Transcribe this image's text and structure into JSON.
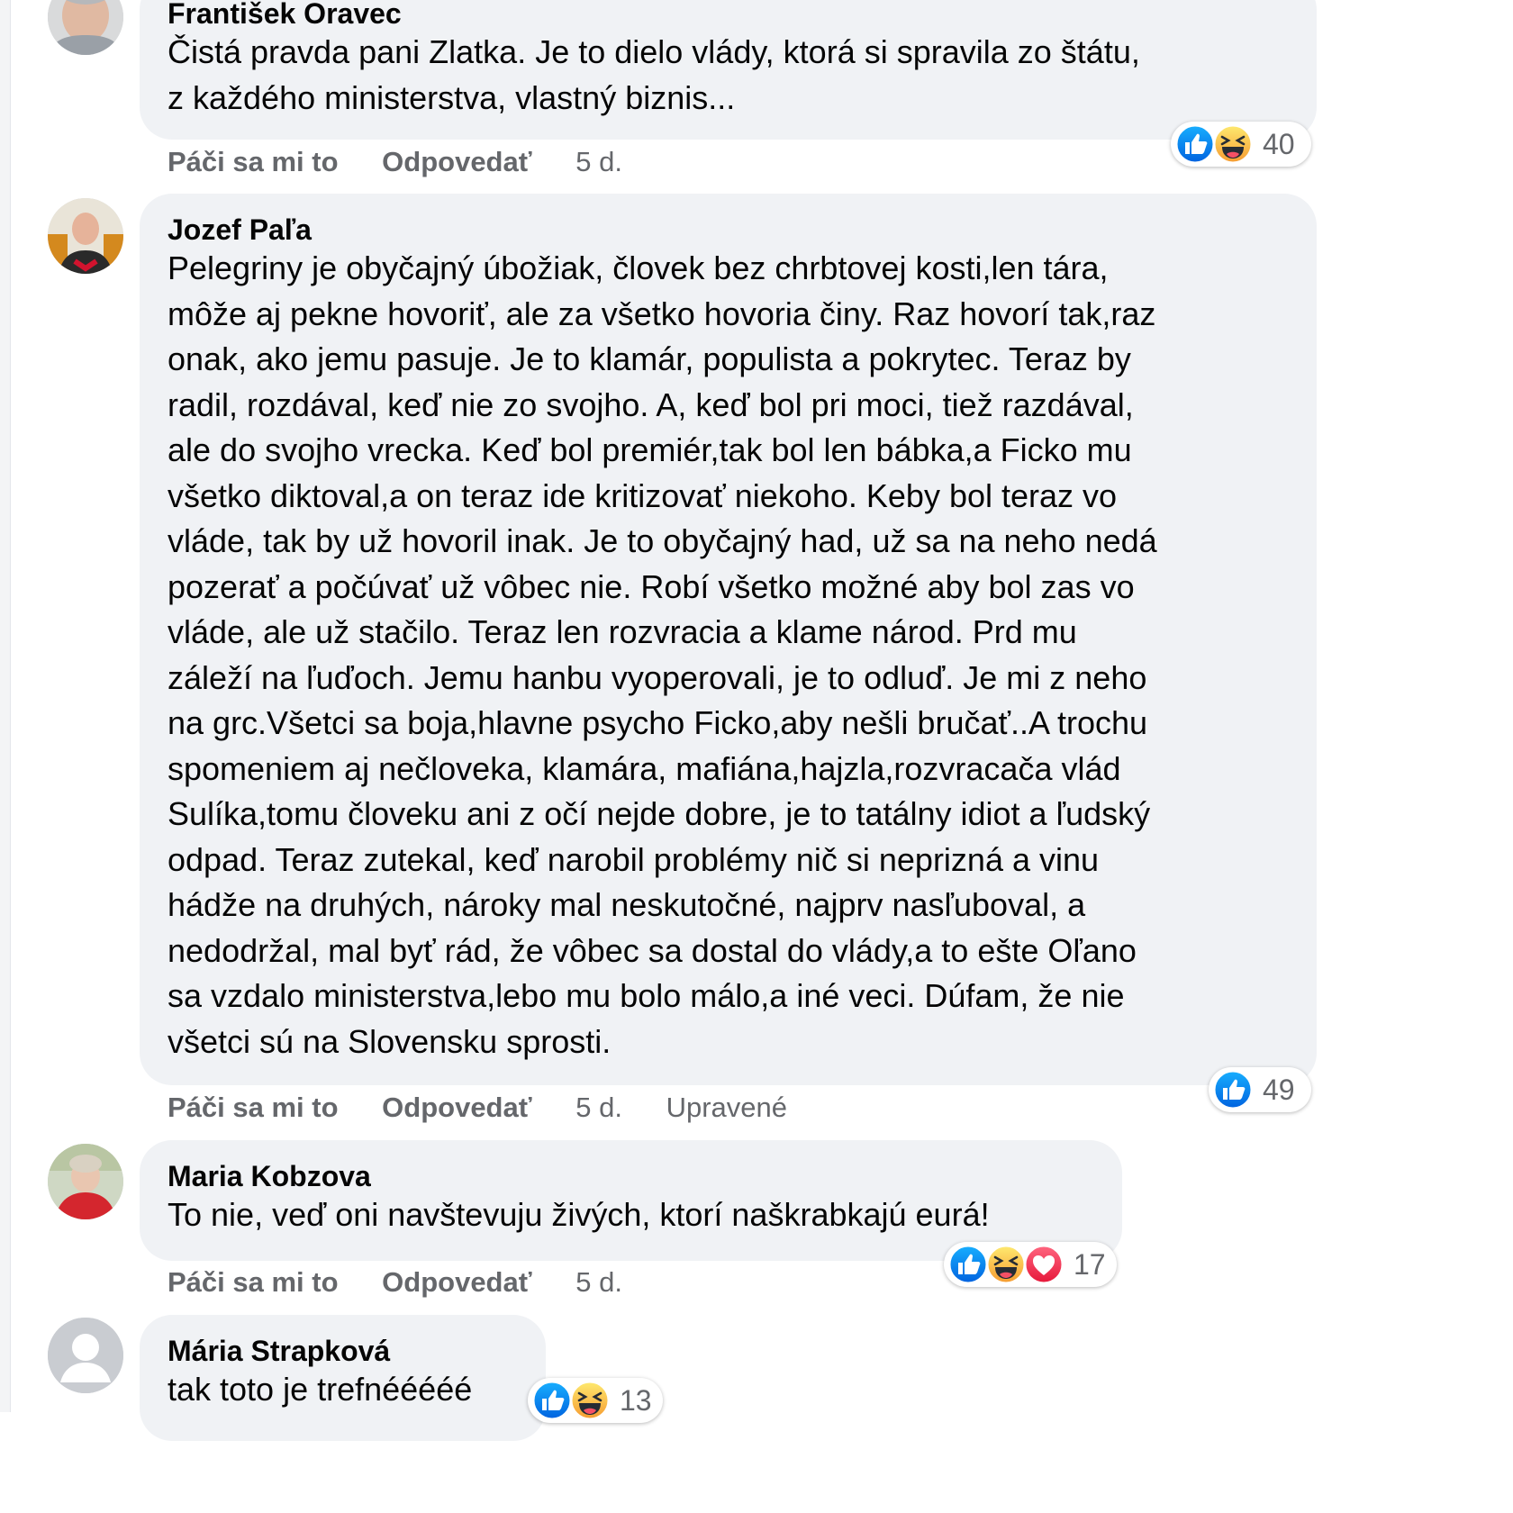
{
  "comments": [
    {
      "author": "František Oravec",
      "text": "Čistá pravda pani Zlatka. Je to dielo vlády, ktorá si spravila zo štátu,\nz každého ministerstva, vlastný biznis...",
      "like_label": "Páči sa mi to",
      "reply_label": "Odpovedať",
      "time": "5 d.",
      "reactions": [
        "like-icon",
        "haha-icon"
      ],
      "reaction_count": "40"
    },
    {
      "author": "Jozef Paľa",
      "text": "Pelegriny je obyčajný úbožiak, človek bez chrbtovej kosti,len tára,\nmôže aj pekne hovoriť, ale za všetko hovoria činy. Raz hovorí tak,raz\nonak, ako jemu pasuje. Je to klamár, populista a pokrytec. Teraz by\nradil, rozdával, keď nie zo svojho. A, keď bol pri moci, tiež razdával,\nale do svojho vrecka. Keď bol premiér,tak bol len bábka,a Ficko mu\nvšetko diktoval,a on teraz ide kritizovať niekoho. Keby bol teraz vo\nvláde, tak by už hovoril inak. Je to obyčajný had, už sa na neho nedá\npozerať a počúvať už vôbec nie. Robí všetko možné aby bol zas vo\nvláde, ale už stačilo. Teraz len rozvracia a klame národ. Prd mu\nzáleží na ľuďoch. Jemu hanbu vyoperovali, je to odluď. Je mi z neho\nna grc.Všetci sa boja,hlavne psycho Ficko,aby nešli bručať..A trochu\nspomeniem aj nečloveka, klamára, mafiána,hajzla,rozvracača vlád\nSulíka,tomu človeku ani z očí nejde dobre, je to tatálny idiot a ľudský\nodpad. Teraz zutekal, keď narobil problémy nič si neprizná a vinu\nhádže na druhých, nároky mal neskutočné, najprv nasľuboval, a\nnedodržal, mal byť rád, že vôbec sa dostal do vlády,a to ešte Oľano\nsa vzdalo ministerstva,lebo mu bolo málo,a iné veci. Dúfam, že nie\nvšetci sú na Slovensku sprosti.",
      "like_label": "Páči sa mi to",
      "reply_label": "Odpovedať",
      "time": "5 d.",
      "edited_label": "Upravené",
      "reactions": [
        "like-icon"
      ],
      "reaction_count": "49"
    },
    {
      "author": "Maria Kobzova",
      "text": "To nie, veď oni navštevuju živých, ktorí naškrabkajú eurá!",
      "like_label": "Páči sa mi to",
      "reply_label": "Odpovedať",
      "time": "5 d.",
      "reactions": [
        "like-icon",
        "haha-icon",
        "love-icon"
      ],
      "reaction_count": "17"
    },
    {
      "author": "Mária Strapková",
      "text": "tak toto je trefnééééé",
      "reactions": [
        "like-icon",
        "haha-icon"
      ],
      "reaction_count": "13"
    }
  ],
  "colors": {
    "bubble": "#f0f2f5",
    "meta_text": "#65676b",
    "like_blue": "#1877f2",
    "haha_yellow": "#f7b125",
    "love_red": "#f33e58"
  }
}
